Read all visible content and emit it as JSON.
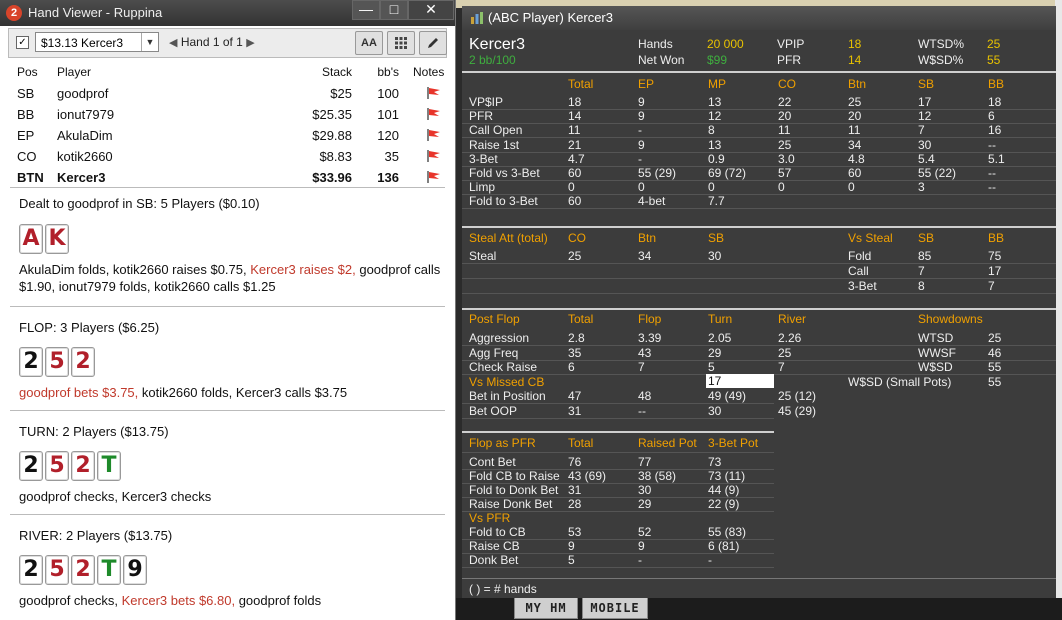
{
  "background": {
    "buttons": [
      "MY HM",
      "MOBILE"
    ]
  },
  "hand_viewer": {
    "title": "Hand Viewer - Ruppina",
    "logo": "2",
    "hand_select": "$13.13 Kercer3",
    "hand_nav": "Hand 1 of 1",
    "tool_aa": "AA",
    "headers": {
      "pos": "Pos",
      "player": "Player",
      "stack": "Stack",
      "bbs": "bb's",
      "notes": "Notes"
    },
    "players": [
      {
        "pos": "SB",
        "player": "goodprof",
        "stack": "$25",
        "bbs": "100"
      },
      {
        "pos": "BB",
        "player": "ionut7979",
        "stack": "$25.35",
        "bbs": "101"
      },
      {
        "pos": "EP",
        "player": "AkulaDim",
        "stack": "$29.88",
        "bbs": "120"
      },
      {
        "pos": "CO",
        "player": "kotik2660",
        "stack": "$8.83",
        "bbs": "35"
      },
      {
        "pos": "BTN",
        "player": "Kercer3",
        "stack": "$33.96",
        "bbs": "136"
      }
    ],
    "preflop": {
      "title": "Dealt to goodprof in SB: 5 Players ($0.10)",
      "cards": [
        {
          "r": "A",
          "s": "h"
        },
        {
          "r": "K",
          "s": "h"
        }
      ],
      "action_1": "AkulaDim folds, kotik2660 raises $0.75, ",
      "action_red": "Kercer3 raises $2,",
      "action_2": " goodprof calls $1.90, ionut7979 folds, kotik2660 calls $1.25"
    },
    "flop": {
      "title": "FLOP: 3 Players ($6.25)",
      "cards": [
        {
          "r": "2",
          "s": "s"
        },
        {
          "r": "5",
          "s": "h"
        },
        {
          "r": "2",
          "s": "h"
        }
      ],
      "action_red": "goodprof bets $3.75,",
      "action_2": " kotik2660 folds, Kercer3 calls $3.75"
    },
    "turn": {
      "title": "TURN: 2 Players ($13.75)",
      "cards": [
        {
          "r": "2",
          "s": "s"
        },
        {
          "r": "5",
          "s": "h"
        },
        {
          "r": "2",
          "s": "h"
        },
        {
          "r": "T",
          "s": "c"
        }
      ],
      "action": "goodprof checks, Kercer3 checks"
    },
    "river": {
      "title": "RIVER: 2 Players ($13.75)",
      "cards": [
        {
          "r": "2",
          "s": "s"
        },
        {
          "r": "5",
          "s": "h"
        },
        {
          "r": "2",
          "s": "h"
        },
        {
          "r": "T",
          "s": "c"
        },
        {
          "r": "9",
          "s": "s"
        }
      ],
      "action_1": "goodprof checks, ",
      "action_red": "Kercer3 bets $6.80,",
      "action_2": " goodprof folds"
    }
  },
  "hud": {
    "title": "(ABC Player) Kercer3",
    "player": "Kercer3",
    "stakes": "2 bb/100",
    "summary": {
      "hands_label": "Hands",
      "hands": "20 000",
      "netwon_label": "Net Won",
      "netwon": "$99",
      "vpip_label": "VPIP",
      "vpip": "18",
      "pfr_label": "PFR",
      "pfr": "14",
      "wtsd_label": "WTSD%",
      "wtsd": "25",
      "wsd_label": "W$SD%",
      "wsd": "55"
    },
    "preflop": {
      "cols": [
        "Total",
        "EP",
        "MP",
        "CO",
        "Btn",
        "SB",
        "BB"
      ],
      "rows": [
        {
          "label": "VP$IP",
          "v": [
            "18",
            "9",
            "13",
            "22",
            "25",
            "17",
            "18"
          ]
        },
        {
          "label": "PFR",
          "v": [
            "14",
            "9",
            "12",
            "20",
            "20",
            "12",
            "6"
          ]
        },
        {
          "label": "Call Open",
          "v": [
            "11",
            "-",
            "8",
            "11",
            "11",
            "7",
            "16"
          ]
        },
        {
          "label": "Raise 1st",
          "v": [
            "21",
            "9",
            "13",
            "25",
            "34",
            "30",
            "--"
          ]
        },
        {
          "label": "3-Bet",
          "v": [
            "4.7",
            "-",
            "0.9",
            "3.0",
            "4.8",
            "5.4",
            "5.1"
          ]
        },
        {
          "label": "Fold vs 3-Bet",
          "v": [
            "60",
            "55 (29)",
            "69 (72)",
            "57",
            "60",
            "55 (22)",
            "--"
          ]
        },
        {
          "label": "Limp",
          "v": [
            "0",
            "0",
            "0",
            "0",
            "0",
            "3",
            "--"
          ]
        },
        {
          "label": "Fold to 3-Bet",
          "v": [
            "60",
            "4-bet",
            "7.7",
            "",
            "",
            "",
            ""
          ]
        }
      ]
    },
    "steal": {
      "title": "Steal Att (total)",
      "cols": [
        "CO",
        "Btn",
        "SB"
      ],
      "row_label": "Steal",
      "row": [
        "25",
        "34",
        "30"
      ],
      "vs_title": "Vs Steal",
      "vs_cols": [
        "SB",
        "BB"
      ],
      "vs_rows": [
        {
          "label": "Fold",
          "v": [
            "85",
            "75"
          ]
        },
        {
          "label": "Call",
          "v": [
            "7",
            "17"
          ]
        },
        {
          "label": "3-Bet",
          "v": [
            "8",
            "7"
          ]
        }
      ]
    },
    "postflop": {
      "title": "Post Flop",
      "cols": [
        "Total",
        "Flop",
        "Turn",
        "River"
      ],
      "rows": [
        {
          "label": "Aggression",
          "v": [
            "2.8",
            "3.39",
            "2.05",
            "2.26"
          ]
        },
        {
          "label": "Agg Freq",
          "v": [
            "35",
            "43",
            "29",
            "25"
          ]
        },
        {
          "label": "Check Raise",
          "v": [
            "6",
            "7",
            "5",
            "7"
          ]
        }
      ],
      "vs_missed_cb": "Vs Missed CB",
      "missed_value": "17",
      "rows2": [
        {
          "label": "Bet in Position",
          "v": [
            "47",
            "48",
            "49 (49)",
            "25 (12)"
          ]
        },
        {
          "label": "Bet OOP",
          "v": [
            "31",
            "--",
            "30",
            "45 (29)"
          ]
        }
      ],
      "showdowns_title": "Showdowns",
      "showdowns": [
        {
          "label": "WTSD",
          "v": "25"
        },
        {
          "label": "WWSF",
          "v": "46"
        },
        {
          "label": "W$SD",
          "v": "55"
        },
        {
          "label": "W$SD (Small Pots)",
          "v": "55"
        }
      ]
    },
    "flop_pfr": {
      "title": "Flop as PFR",
      "cols": [
        "Total",
        "Raised Pot",
        "3-Bet Pot"
      ],
      "rows": [
        {
          "label": "Cont Bet",
          "v": [
            "76",
            "77",
            "73"
          ]
        },
        {
          "label": "Fold CB to Raise",
          "v": [
            "43 (69)",
            "38 (58)",
            "73 (11)"
          ]
        },
        {
          "label": "Fold to Donk Bet",
          "v": [
            "31",
            "30",
            "44 (9)"
          ]
        },
        {
          "label": "Raise Donk Bet",
          "v": [
            "28",
            "29",
            "22 (9)"
          ]
        }
      ],
      "vs_pfr": "Vs PFR",
      "rows2": [
        {
          "label": "Fold to CB",
          "v": [
            "53",
            "52",
            "55 (83)"
          ]
        },
        {
          "label": "Raise CB",
          "v": [
            "9",
            "9",
            "6 (81)"
          ]
        },
        {
          "label": "Donk Bet",
          "v": [
            "5",
            "-",
            "-"
          ]
        }
      ]
    },
    "footnote": "( ) = # hands"
  }
}
